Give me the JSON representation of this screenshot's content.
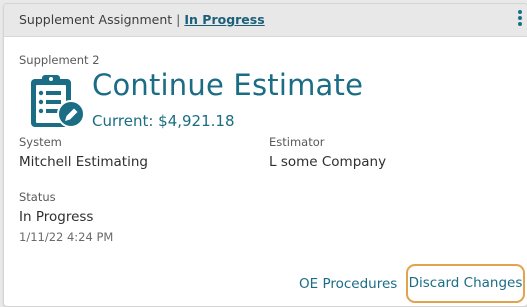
{
  "header": {
    "title": "Supplement Assignment",
    "separator": "|",
    "status_link": "In Progress",
    "menu_icon": "kebab-vertical-icon"
  },
  "main": {
    "supplement_label": "Supplement 2",
    "icon": "clipboard-edit-icon",
    "title": "Continue Estimate",
    "current": "Current: $4,921.18",
    "fields": {
      "system_label": "System",
      "system_value": "Mitchell Estimating",
      "estimator_label": "Estimator",
      "estimator_value": "L some Company",
      "status_label": "Status",
      "status_value": "In Progress",
      "status_date": "1/11/22 4:24 PM"
    }
  },
  "actions": {
    "oe_procedures": "OE Procedures",
    "discard_changes": "Discard Changes"
  },
  "colors": {
    "accent": "#1a6d84",
    "header_bg": "#e8e8e8",
    "focus_outline": "#e3a24c"
  }
}
